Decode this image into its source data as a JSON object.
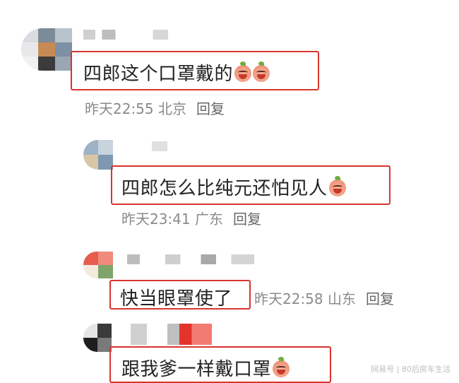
{
  "comments": [
    {
      "text": "四郎这个口罩戴的",
      "meta": "昨天22:55 北京",
      "reply": "回复",
      "emojis": [
        "grin-emoji",
        "grin-emoji"
      ]
    },
    {
      "text": "四郎怎么比纯元还怕见人",
      "meta": "昨天23:41 广东",
      "reply": "回复",
      "emojis": [
        "laugh-cry-emoji"
      ]
    },
    {
      "text": "快当眼罩使了",
      "meta": "昨天22:58 山东",
      "reply": "回复",
      "emojis": []
    },
    {
      "text": "跟我爹一样戴口罩",
      "meta": "",
      "reply": "",
      "emojis": [
        "cry-emoji"
      ]
    }
  ],
  "watermark": "网易号 | 80后房车生活",
  "colors": {
    "highlight_border": "#d8342e",
    "meta_text": "#8a8a8a"
  }
}
